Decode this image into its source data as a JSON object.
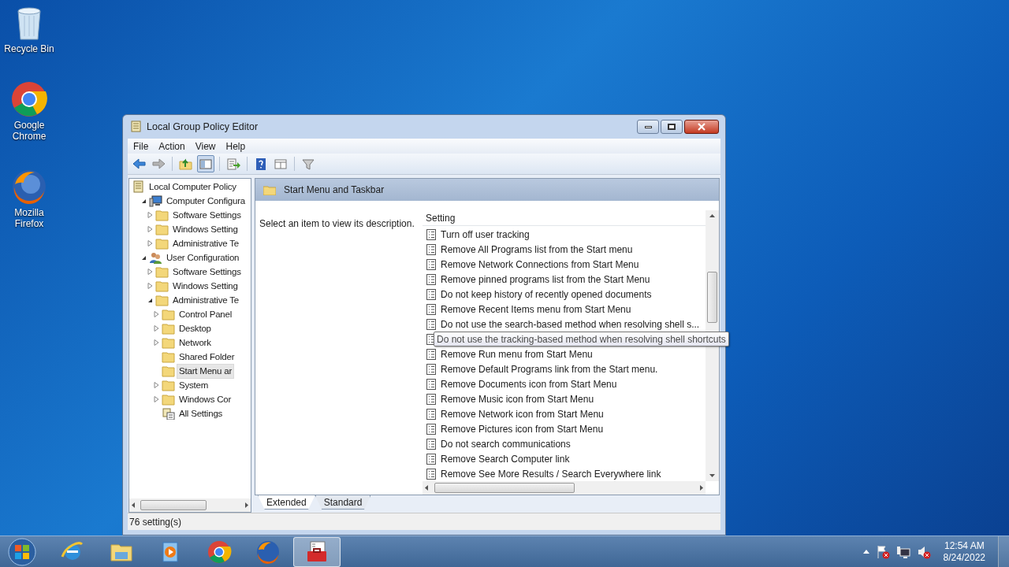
{
  "desktop_icons": [
    {
      "kind": "recycle",
      "label": "Recycle Bin"
    },
    {
      "kind": "chrome",
      "label": "Google Chrome"
    },
    {
      "kind": "firefox",
      "label": "Mozilla Firefox"
    }
  ],
  "window": {
    "title": "Local Group Policy Editor"
  },
  "menu": [
    "File",
    "Action",
    "View",
    "Help"
  ],
  "toolbar": [
    {
      "kind": "back",
      "pressed": false
    },
    {
      "kind": "forward",
      "pressed": false
    },
    {
      "kind": "sep"
    },
    {
      "kind": "up",
      "pressed": false
    },
    {
      "kind": "tree",
      "pressed": true
    },
    {
      "kind": "sep"
    },
    {
      "kind": "export",
      "pressed": false
    },
    {
      "kind": "sep"
    },
    {
      "kind": "help",
      "pressed": false
    },
    {
      "kind": "view",
      "pressed": false
    },
    {
      "kind": "sep"
    },
    {
      "kind": "filter",
      "pressed": false
    }
  ],
  "tree": [
    {
      "kind": "policy",
      "label": "Local Computer Policy",
      "selected": false,
      "children": [
        {
          "kind": "computer",
          "label": "Computer Configura",
          "expanded": true,
          "selected": false,
          "children": [
            {
              "kind": "folder",
              "label": "Software Settings",
              "expanded": false,
              "selected": false
            },
            {
              "kind": "folder",
              "label": "Windows Setting",
              "expanded": false,
              "selected": false
            },
            {
              "kind": "folder",
              "label": "Administrative Te",
              "expanded": false,
              "selected": false
            }
          ]
        },
        {
          "kind": "user",
          "label": "User Configuration",
          "expanded": true,
          "selected": false,
          "children": [
            {
              "kind": "folder",
              "label": "Software Settings",
              "expanded": false,
              "selected": false
            },
            {
              "kind": "folder",
              "label": "Windows Setting",
              "expanded": false,
              "selected": false
            },
            {
              "kind": "folder",
              "label": "Administrative Te",
              "expanded": true,
              "selected": false,
              "children": [
                {
                  "kind": "folder",
                  "label": "Control Panel",
                  "expanded": false,
                  "selected": false
                },
                {
                  "kind": "folder",
                  "label": "Desktop",
                  "expanded": false,
                  "selected": false
                },
                {
                  "kind": "folder",
                  "label": "Network",
                  "expanded": false,
                  "selected": false
                },
                {
                  "kind": "folder",
                  "label": "Shared Folder",
                  "selected": false
                },
                {
                  "kind": "folder",
                  "label": "Start Menu ar",
                  "selected": true
                },
                {
                  "kind": "folder",
                  "label": "System",
                  "expanded": false,
                  "selected": false
                },
                {
                  "kind": "folder",
                  "label": "Windows Cor",
                  "expanded": false,
                  "selected": false
                },
                {
                  "kind": "settings",
                  "label": "All Settings",
                  "selected": false
                }
              ]
            }
          ]
        }
      ]
    }
  ],
  "details": {
    "heading": "Start Menu and Taskbar",
    "description": "Select an item to view its description.",
    "column": "Setting",
    "settings": [
      {
        "label": "Turn off user tracking"
      },
      {
        "label": "Remove All Programs list from the Start menu"
      },
      {
        "label": "Remove Network Connections from Start Menu"
      },
      {
        "label": "Remove pinned programs list from the Start Menu"
      },
      {
        "label": "Do not keep history of recently opened documents"
      },
      {
        "label": "Remove Recent Items menu from Start Menu"
      },
      {
        "label": "Do not use the search-based method when resolving shell s..."
      },
      {
        "tooltip": "Do not use the tracking-based method when resolving shell shortcuts"
      },
      {
        "label": "Remove Run menu from Start Menu"
      },
      {
        "label": "Remove Default Programs link from the Start menu."
      },
      {
        "label": "Remove Documents icon from Start Menu"
      },
      {
        "label": "Remove Music icon from Start Menu"
      },
      {
        "label": "Remove Network icon from Start Menu"
      },
      {
        "label": "Remove Pictures icon from Start Menu"
      },
      {
        "label": "Do not search communications"
      },
      {
        "label": "Remove Search Computer link"
      },
      {
        "label": "Remove See More Results / Search Everywhere link"
      }
    ],
    "tabs": [
      {
        "label": "Extended",
        "selected": true
      },
      {
        "label": "Standard",
        "selected": false
      }
    ]
  },
  "status_bar": "76 setting(s)",
  "taskbar": [
    {
      "kind": "ie",
      "active": false
    },
    {
      "kind": "explorer",
      "active": false
    },
    {
      "kind": "media",
      "active": false
    },
    {
      "kind": "chrome",
      "active": false
    },
    {
      "kind": "firefox",
      "active": false
    },
    {
      "kind": "toolbox",
      "active": true
    }
  ],
  "clock": {
    "time": "12:54 AM",
    "date": "8/24/2022"
  }
}
